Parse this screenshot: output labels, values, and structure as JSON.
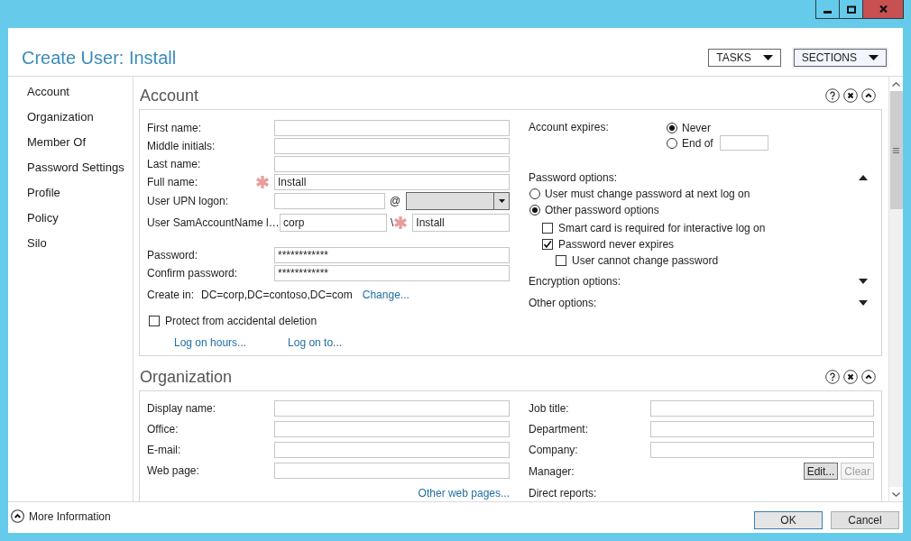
{
  "window": {
    "title": "Create User: Install"
  },
  "header_buttons": [
    {
      "label": "TASKS",
      "highlighted": false
    },
    {
      "label": "SECTIONS",
      "highlighted": true
    }
  ],
  "sidebar": {
    "items": [
      {
        "label": "Account"
      },
      {
        "label": "Organization"
      },
      {
        "label": "Member Of"
      },
      {
        "label": "Password Settings"
      },
      {
        "label": "Profile"
      },
      {
        "label": "Policy"
      },
      {
        "label": "Silo"
      }
    ]
  },
  "account": {
    "title": "Account",
    "name_fields": [
      {
        "label": "First name:",
        "required": false
      },
      {
        "label": "Middle initials:",
        "required": false
      },
      {
        "label": "Last name:",
        "required": false
      },
      {
        "label": "Full name:",
        "required": true,
        "value": "Install"
      }
    ],
    "upn_logon": {
      "label": "User UPN logon:",
      "separator": "@",
      "suffix_disabled": true
    },
    "sam_account": {
      "label": "User SamAccountName l…",
      "domain": "corp",
      "separator": "\\",
      "required": true,
      "value": "Install"
    },
    "password_fields": [
      {
        "label": "Password:",
        "value": "************"
      },
      {
        "label": "Confirm password:",
        "value": "************"
      }
    ],
    "create_in": {
      "label": "Create in:",
      "value": "DC=corp,DC=contoso,DC=com",
      "link": "Change..."
    },
    "protect": {
      "label": "Protect from accidental deletion",
      "checked": false
    },
    "links": [
      "Log on hours...",
      "Log on to..."
    ],
    "account_expires": {
      "label": "Account expires:",
      "options": [
        {
          "label": "Never",
          "selected": true
        },
        {
          "label": "End of",
          "selected": false
        }
      ]
    },
    "option_groups": [
      {
        "label": "Password options:",
        "expanded": true,
        "options": [
          {
            "label": "User must change password at next log on",
            "selected": false
          },
          {
            "label": "Other password options",
            "selected": true
          }
        ],
        "checkboxes": [
          {
            "label": "Smart card is required for interactive log on",
            "checked": false
          },
          {
            "label": "Password never expires",
            "checked": true,
            "children": [
              {
                "label": "User cannot change password",
                "checked": false
              }
            ]
          }
        ]
      },
      {
        "label": "Encryption options:",
        "expanded": false
      },
      {
        "label": "Other options:",
        "expanded": false
      }
    ]
  },
  "organization": {
    "title": "Organization",
    "left_fields": [
      {
        "label": "Display name:"
      },
      {
        "label": "Office:"
      },
      {
        "label": "E-mail:"
      },
      {
        "label": "Web page:"
      }
    ],
    "link": "Other web pages...",
    "right_fields": [
      {
        "label": "Job title:"
      },
      {
        "label": "Department:"
      },
      {
        "label": "Company:"
      }
    ],
    "manager": {
      "label": "Manager:",
      "buttons": [
        {
          "label": "Edit...",
          "disabled": false
        },
        {
          "label": "Clear",
          "disabled": true
        }
      ]
    },
    "direct_reports": {
      "label": "Direct reports:"
    }
  },
  "footer": {
    "more_information": "More Information",
    "buttons": [
      {
        "label": "OK",
        "default": true
      },
      {
        "label": "Cancel",
        "default": false
      }
    ]
  }
}
